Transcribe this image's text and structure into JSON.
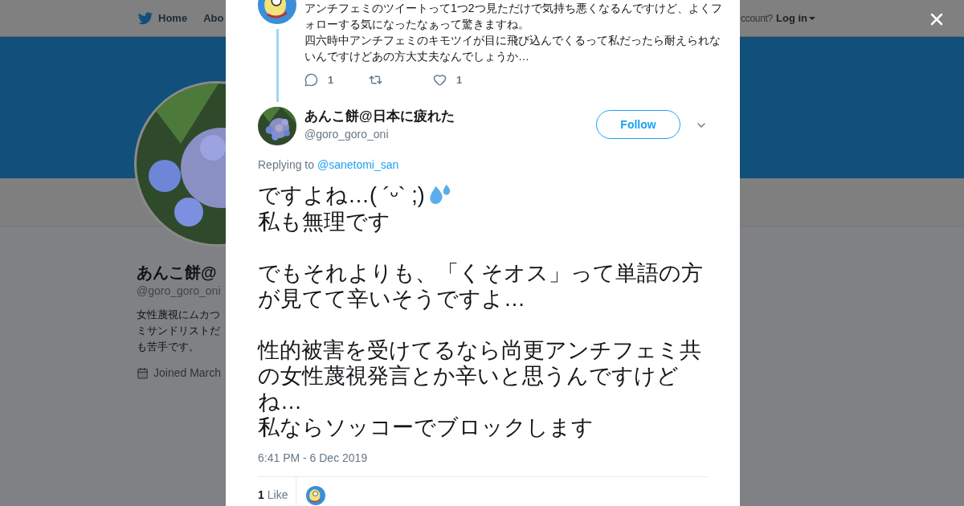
{
  "nav": {
    "items": [
      {
        "label": "Home",
        "kind": "home"
      },
      {
        "label": "Abo",
        "kind": "plain"
      }
    ],
    "account_prompt": "ccount?",
    "login": "Log in"
  },
  "profile": {
    "name": "あんこ餅@",
    "handle": "@goro_goro_oni",
    "bio": [
      "女性蔑視にムカつ",
      "ミサンドリストだ",
      "も苦手です。"
    ],
    "joined": "Joined March"
  },
  "parent_tweet": {
    "lines": [
      "アンチフェミのツイートって1つ2つ見ただけで気持ち悪くなるんですけど、よくフォローする気になったなぁって驚きますね。",
      "四六時中アンチフェミのキモツイが目に飛び込んでくるって私だったら耐えられないんですけどあの方大丈夫なんでしょうか…"
    ],
    "actions": [
      {
        "kind": "reply",
        "count": "1"
      },
      {
        "kind": "retweet"
      },
      {
        "kind": "like",
        "count": "1"
      }
    ]
  },
  "tweet": {
    "name": "あんこ餅@日本に疲れた",
    "handle": "@goro_goro_oni",
    "follow": "Follow",
    "replying_prefix": "Replying to",
    "replying_to": "@sanetomi_san",
    "paragraphs": [
      [
        {
          "text": "ですよね…( ´ᵕ` ;)",
          "emoji": true
        },
        {
          "text": "私も無理です"
        }
      ],
      [
        {
          "text": "でもそれよりも、「くそオス」って単語の方が見てて辛いそうですよ…"
        }
      ],
      [
        {
          "text": "性的被害を受けてるなら尚更アンチフェミ共の女性蔑視発言とか辛いと思うんですけどね…"
        },
        {
          "text": "私ならソッコーでブロックします"
        }
      ]
    ],
    "timestamp": "6:41 PM - 6 Dec 2019",
    "likes": {
      "count": "1",
      "label": "Like"
    }
  }
}
